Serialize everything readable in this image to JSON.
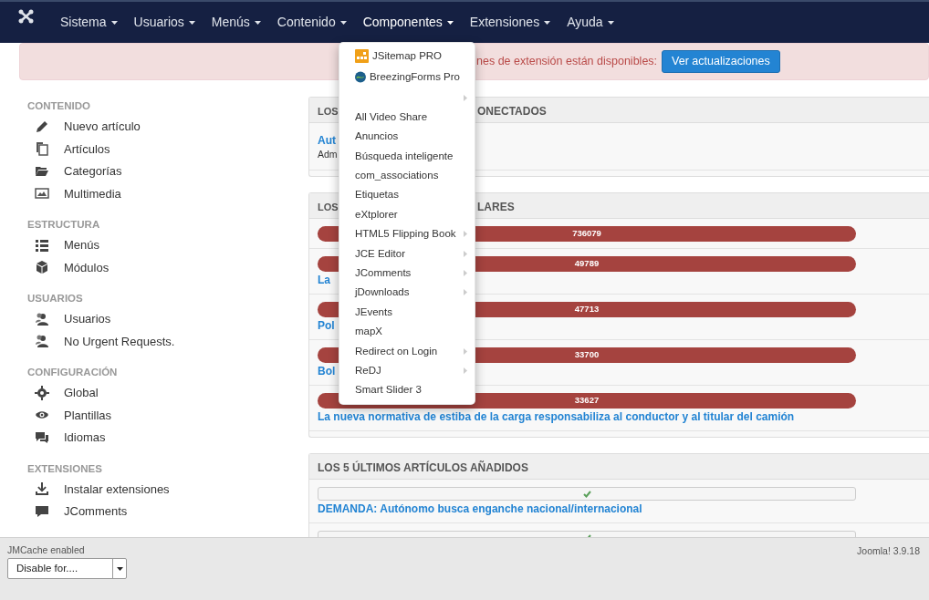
{
  "navbar": {
    "items": [
      {
        "label": "Sistema",
        "selected": false
      },
      {
        "label": "Usuarios",
        "selected": false
      },
      {
        "label": "Menús",
        "selected": false
      },
      {
        "label": "Contenido",
        "selected": false
      },
      {
        "label": "Componentes",
        "selected": true
      },
      {
        "label": "Extensiones",
        "selected": false
      },
      {
        "label": "Ayuda",
        "selected": false
      }
    ]
  },
  "alert": {
    "message": "nes de extensión están disponibles:",
    "button": "Ver actualizaciones"
  },
  "sidebar": {
    "sections": [
      {
        "heading": "CONTENIDO",
        "items": [
          {
            "label": "Nuevo artículo"
          },
          {
            "label": "Artículos"
          },
          {
            "label": "Categorías"
          },
          {
            "label": "Multimedia"
          }
        ]
      },
      {
        "heading": "ESTRUCTURA",
        "items": [
          {
            "label": "Menús"
          },
          {
            "label": "Módulos"
          }
        ]
      },
      {
        "heading": "USUARIOS",
        "items": [
          {
            "label": "Usuarios"
          },
          {
            "label": "No Urgent Requests."
          }
        ]
      },
      {
        "heading": "CONFIGURACIÓN",
        "items": [
          {
            "label": "Global"
          },
          {
            "label": "Plantillas"
          },
          {
            "label": "Idiomas"
          }
        ]
      },
      {
        "heading": "EXTENSIONES",
        "items": [
          {
            "label": "Instalar extensiones"
          },
          {
            "label": "JComments"
          }
        ]
      }
    ]
  },
  "panels": [
    {
      "kind": "logged",
      "title_left": "LOS",
      "title_right": "ONECTADOS",
      "rows": [
        {
          "link": "Aut",
          "sub": "Adm"
        }
      ]
    },
    {
      "kind": "popular",
      "title_left": "LOS",
      "title_right": "LARES",
      "rows": [
        {
          "hits": "736079"
        },
        {
          "hits": "49789",
          "link": "La"
        },
        {
          "hits": "47713",
          "link": "Pol"
        },
        {
          "hits": "33700",
          "link": "Bol"
        },
        {
          "hits": "33627",
          "link": "La nueva normativa de estiba de la carga responsabiliza al conductor y al titular del camión"
        }
      ]
    },
    {
      "kind": "latest",
      "title_left": "LOS 5 ÚLTIMOS ARTÍCULOS AÑADIDOS",
      "rows": [
        {
          "link": "DEMANDA: Autónomo busca enganche nacional/internacional"
        },
        {}
      ]
    }
  ],
  "dropdown": {
    "items": [
      {
        "label": "JSitemap PRO",
        "submenu": false
      },
      {
        "label": "BreezingForms Pro",
        "submenu": false
      },
      {
        "submenu": true
      },
      {
        "label": "All Video Share",
        "submenu": false
      },
      {
        "label": "Anuncios",
        "submenu": false
      },
      {
        "label": "Búsqueda inteligente",
        "submenu": false
      },
      {
        "label": "com_associations",
        "submenu": false
      },
      {
        "label": "Etiquetas",
        "submenu": false
      },
      {
        "label": "eXtplorer",
        "submenu": false
      },
      {
        "label": "HTML5 Flipping Book",
        "submenu": true
      },
      {
        "label": "JCE Editor",
        "submenu": true
      },
      {
        "label": "JComments",
        "submenu": true
      },
      {
        "label": "jDownloads",
        "submenu": true
      },
      {
        "label": "JEvents",
        "submenu": false
      },
      {
        "label": "mapX",
        "submenu": false
      },
      {
        "label": "Redirect on Login",
        "submenu": true
      },
      {
        "label": "ReDJ",
        "submenu": true
      },
      {
        "label": "Smart Slider 3",
        "submenu": false
      }
    ]
  },
  "footer": {
    "status": "JMCache enabled",
    "select_value": "Disable for....",
    "version": "Joomla! 3.9.18"
  }
}
